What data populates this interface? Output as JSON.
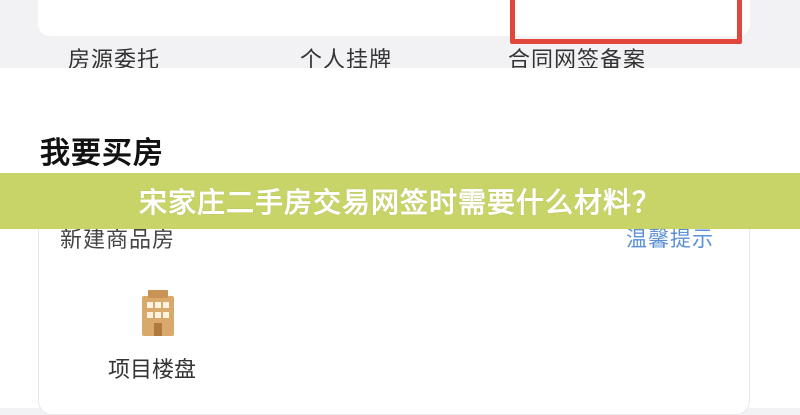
{
  "top_services": {
    "items": [
      {
        "label": "房源委托"
      },
      {
        "label": "个人挂牌"
      },
      {
        "label": "合同网签备案"
      }
    ],
    "highlight_color": "#e0463b"
  },
  "buy_section": {
    "title": "我要买房",
    "card": {
      "title": "新建商品房",
      "tip_label": "温馨提示",
      "project": {
        "label": "项目楼盘",
        "icon": "building-icon"
      }
    }
  },
  "banner": {
    "text": "宋家庄二手房交易网签时需要什么材料？",
    "background": "#c4d05c"
  },
  "colors": {
    "accent_link": "#5b8fd6",
    "icon": "#d9a86b"
  }
}
